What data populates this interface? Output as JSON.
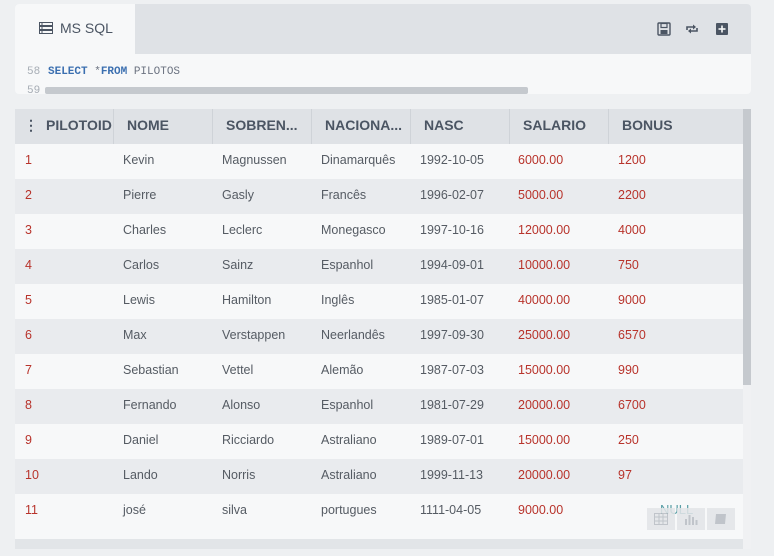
{
  "editor": {
    "tab_label": "MS SQL",
    "lines": [
      {
        "num": "58",
        "kw1": "SELECT",
        "mid": " *",
        "kw2": "FROM",
        "rest": " PILOTOS"
      },
      {
        "num": "59"
      }
    ]
  },
  "toolbar": {
    "icons": [
      "save-icon",
      "refresh-icon",
      "add-icon"
    ]
  },
  "grid": {
    "headers": [
      "PILOTOID",
      "NOME",
      "SOBREN...",
      "NACIONA...",
      "NASC",
      "SALARIO",
      "BONUS"
    ],
    "sort_icon": "⋮",
    "rows": [
      {
        "id": "1",
        "nome": "Kevin",
        "sobrenome": "Magnussen",
        "nac": "Dinamarquês",
        "nasc": "1992-10-05",
        "salario": "6000.00",
        "bonus": "1200"
      },
      {
        "id": "2",
        "nome": "Pierre",
        "sobrenome": "Gasly",
        "nac": "Francês",
        "nasc": "1996-02-07",
        "salario": "5000.00",
        "bonus": "2200"
      },
      {
        "id": "3",
        "nome": "Charles",
        "sobrenome": "Leclerc",
        "nac": "Monegasco",
        "nasc": "1997-10-16",
        "salario": "12000.00",
        "bonus": "4000"
      },
      {
        "id": "4",
        "nome": "Carlos",
        "sobrenome": "Sainz",
        "nac": "Espanhol",
        "nasc": "1994-09-01",
        "salario": "10000.00",
        "bonus": "750"
      },
      {
        "id": "5",
        "nome": "Lewis",
        "sobrenome": "Hamilton",
        "nac": "Inglês",
        "nasc": "1985-01-07",
        "salario": "40000.00",
        "bonus": "9000"
      },
      {
        "id": "6",
        "nome": "Max",
        "sobrenome": "Verstappen",
        "nac": "Neerlandês",
        "nasc": "1997-09-30",
        "salario": "25000.00",
        "bonus": "6570"
      },
      {
        "id": "7",
        "nome": "Sebastian",
        "sobrenome": "Vettel",
        "nac": "Alemão",
        "nasc": "1987-07-03",
        "salario": "15000.00",
        "bonus": "990"
      },
      {
        "id": "8",
        "nome": "Fernando",
        "sobrenome": "Alonso",
        "nac": "Espanhol",
        "nasc": "1981-07-29",
        "salario": "20000.00",
        "bonus": "6700"
      },
      {
        "id": "9",
        "nome": "Daniel",
        "sobrenome": "Ricciardo",
        "nac": "Astraliano",
        "nasc": "1989-07-01",
        "salario": "15000.00",
        "bonus": "250"
      },
      {
        "id": "10",
        "nome": "Lando",
        "sobrenome": "Norris",
        "nac": "Astraliano",
        "nasc": "1999-11-13",
        "salario": "20000.00",
        "bonus": "97"
      },
      {
        "id": "11",
        "nome": "josé",
        "sobrenome": "silva",
        "nac": "portugues",
        "nasc": "1111-04-05",
        "salario": "9000.00",
        "bonus": "NULL"
      }
    ],
    "footer_icons": [
      "table-icon",
      "chart-icon",
      "book-icon"
    ]
  },
  "colors": {
    "accent_red": "#b8332b",
    "null_teal": "#5a9fa6",
    "keyword_blue": "#3b6fb0"
  }
}
